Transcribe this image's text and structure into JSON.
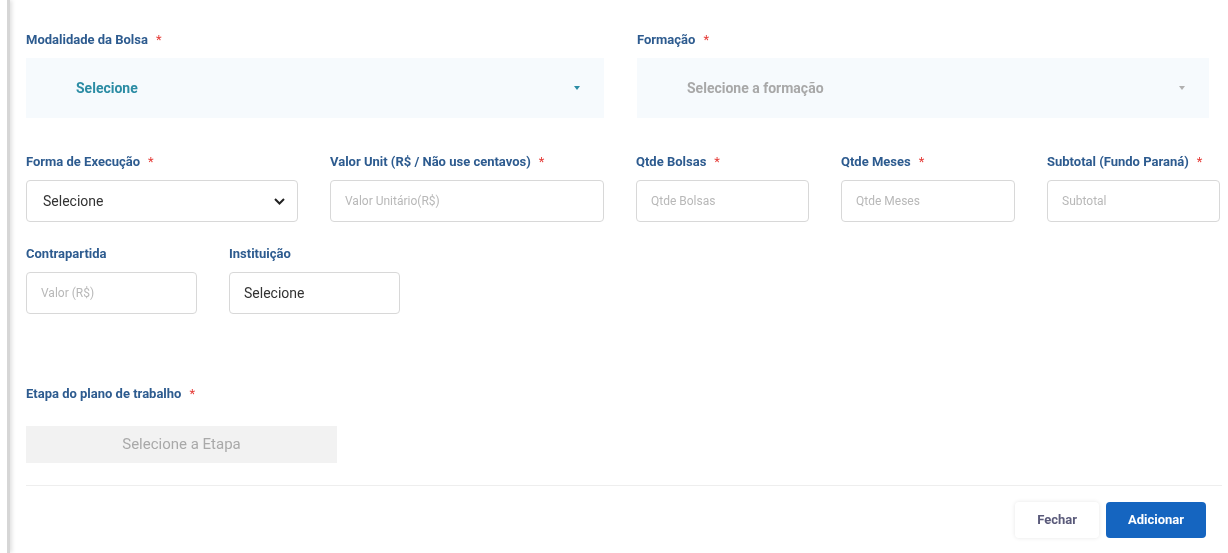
{
  "rows": [
    [
      {
        "label": "Modalidade da Bolsa",
        "required_mark": "*",
        "kind": "dropdown",
        "value": "Selecione"
      },
      {
        "label": "Formação",
        "required_mark": "*",
        "kind": "dropdown",
        "placeholder": "Selecione a formação"
      }
    ],
    [
      {
        "label": "Forma de Execução",
        "required_mark": "*",
        "kind": "select",
        "value": "Selecione"
      },
      {
        "label": "Valor Unit (R$ / Não use centavos)",
        "required_mark": "*",
        "kind": "input",
        "placeholder": "Valor Unitário(R$)"
      },
      {
        "label": "Qtde Bolsas",
        "required_mark": "*",
        "kind": "input",
        "placeholder": "Qtde Bolsas"
      },
      {
        "label": "Qtde Meses",
        "required_mark": "*",
        "kind": "input",
        "placeholder": "Qtde Meses"
      },
      {
        "label": "Subtotal (Fundo Paraná)",
        "required_mark": "*",
        "kind": "input",
        "placeholder": "Subtotal"
      }
    ],
    [
      {
        "label": "Contrapartida",
        "kind": "input",
        "placeholder": "Valor (R$)"
      },
      {
        "label": "Instituição",
        "kind": "input",
        "value": "Selecione"
      }
    ]
  ],
  "etapa": {
    "label": "Etapa do plano de trabalho",
    "required_mark": "*",
    "placeholder": "Selecione a Etapa",
    "disabled": true
  },
  "buttons": [
    {
      "label": "Fechar",
      "primary": false
    },
    {
      "label": "Adicionar",
      "primary": true
    }
  ]
}
